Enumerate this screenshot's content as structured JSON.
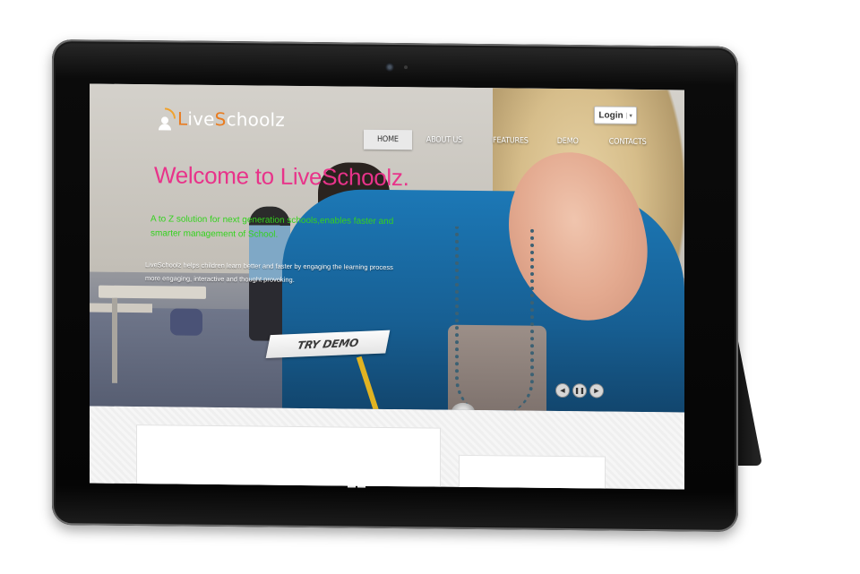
{
  "site": {
    "logo": {
      "part1": "L",
      "part2": "ive",
      "part3": "S",
      "part4": "choolz"
    },
    "login_label": "Login",
    "login_caret": "▾",
    "nav": [
      "HOME",
      "ABOUT US",
      "FEATURES",
      "DEMO",
      "CONTACTS"
    ],
    "active_nav": "HOME"
  },
  "hero": {
    "welcome": "Welcome to LiveSchoolz.",
    "tagline": "A to Z solution for next generation schools,enables faster and smarter management of School.",
    "description": "LiveSchoolz helps children learn better and faster by engaging the learning process more engaging, interactive and thought provoking.",
    "cta": "TRY DEMO",
    "controls": {
      "prev": "◀",
      "pause": "❚❚",
      "next": "▶"
    }
  },
  "colors": {
    "welcome": "#e8338a",
    "tagline": "#34d21e",
    "logo_accent": "#e97c20"
  },
  "icons": [
    "camera-icon",
    "windows-logo-icon",
    "signal-icon",
    "person-icon"
  ]
}
